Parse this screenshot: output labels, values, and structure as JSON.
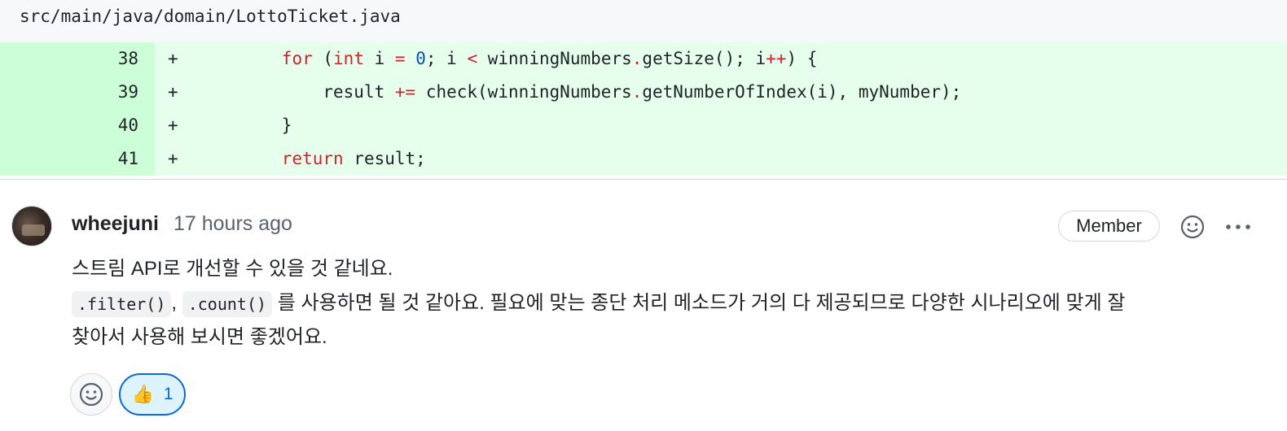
{
  "file": {
    "path": "src/main/java/domain/LottoTicket.java"
  },
  "diff_lines": [
    {
      "num": "38",
      "marker": "+"
    },
    {
      "num": "39",
      "marker": "+"
    },
    {
      "num": "40",
      "marker": "+"
    },
    {
      "num": "41",
      "marker": "+"
    }
  ],
  "comment": {
    "author": "wheejuni",
    "time": "17 hours ago",
    "badge": "Member",
    "line1": "스트림 API로 개선할 수 있을 것 같네요.",
    "code_filter": ".filter()",
    "sep": ",",
    "code_count": ".count()",
    "line2_rest": "를 사용하면 될 것 같아요. 필요에 맞는 종단 처리 메소드가 거의 다 제공되므로 다양한 시나리오에 맞게 잘",
    "line3": "찾아서 사용해 보시면 좋겠어요."
  },
  "reactions": {
    "thumbs_up_emoji": "👍",
    "thumbs_up_count": "1"
  },
  "icons": [
    "smiley-icon",
    "kebab-horizontal-icon",
    "thumbs-up-icon"
  ],
  "colors": {
    "added_bg": "#e6ffec",
    "added_gutter": "#ccffd8",
    "keyword": "#cf222e",
    "number": "#0550ae",
    "accent": "#0969da"
  }
}
